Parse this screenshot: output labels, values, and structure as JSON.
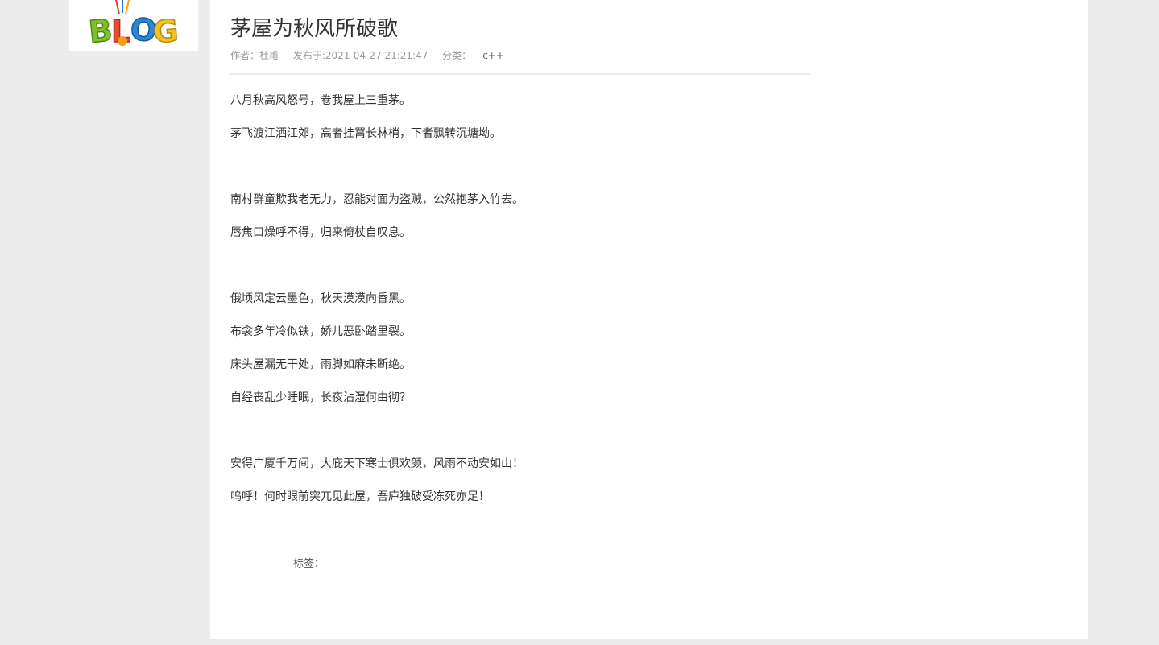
{
  "logo": {
    "text": "BLOG"
  },
  "article": {
    "title": "茅屋为秋风所破歌",
    "meta": {
      "author": "作者：杜甫",
      "published": "发布于:2021-04-27 21:21:47",
      "category_label": "分类：",
      "category_link": "c++"
    },
    "lines": [
      "八月秋高风怒号，卷我屋上三重茅。",
      "茅飞渡江洒江郊，高者挂罥长林梢，下者飘转沉塘坳。",
      "",
      "南村群童欺我老无力，忍能对面为盗贼，公然抱茅入竹去。",
      "唇焦口燥呼不得，归来倚杖自叹息。",
      "",
      "俄顷风定云墨色，秋天漠漠向昏黑。",
      "布衾多年冷似铁，娇儿恶卧踏里裂。",
      "床头屋漏无干处，雨脚如麻未断绝。",
      "自经丧乱少睡眠，长夜沾湿何由彻？",
      "",
      "安得广厦千万间，大庇天下寒士俱欢颜，风雨不动安如山！",
      "呜呼！何时眼前突兀见此屋，吾庐独破受冻死亦足！"
    ],
    "tags_label": "标签："
  }
}
